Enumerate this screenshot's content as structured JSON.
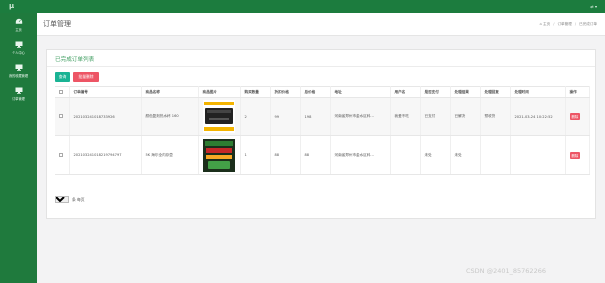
{
  "topbar": {
    "logo": "μ",
    "user_label": "⇄ ▾"
  },
  "sidebar": {
    "items": [
      {
        "label": "主页",
        "icon": "dashboard-icon"
      },
      {
        "label": "个人中心",
        "icon": "monitor-icon"
      },
      {
        "label": "我的收藏管理",
        "icon": "monitor-icon"
      },
      {
        "label": "订单管理",
        "icon": "monitor-icon"
      }
    ]
  },
  "header": {
    "title": "订单管理",
    "breadcrumb": [
      "⌂ 主页",
      "订单管理",
      "已完成订单"
    ]
  },
  "card": {
    "title": "已完成订单列表",
    "search_label": "查询",
    "batch_delete_label": "批量删除"
  },
  "table": {
    "columns": [
      "订单编号",
      "商品名称",
      "商品图片",
      "购买数量",
      "折扣价格",
      "总价格",
      "地址",
      "用户名",
      "是否支付",
      "处理结果",
      "处理回复",
      "处理时间",
      "操作"
    ],
    "rows": [
      {
        "order_no": "202103241018733926",
        "product": "颜色复刻热水杯 160",
        "image": "product-image-bag",
        "quantity": "2",
        "discount_price": "99",
        "total_price": "198",
        "address": "河南省郑州市金水区科...",
        "username": "我爱不吃",
        "paid": "已支付",
        "result": "已解决",
        "reply": "预收货",
        "time": "2021-03-24 10:22:52",
        "action": "删除"
      },
      {
        "order_no": "202103241018219794797",
        "product": "5K 海尔全内存壶",
        "image": "product-image-drink",
        "quantity": "1",
        "discount_price": "88",
        "total_price": "88",
        "address": "河南省郑州市金水区科...",
        "username": "",
        "paid": "未处",
        "result": "未处",
        "reply": "",
        "time": "",
        "action": "删除"
      }
    ]
  },
  "pager": {
    "page_size": "10",
    "suffix": "条 每页",
    "current_page": "1"
  },
  "watermark": "CSDN @2401_85762266",
  "colors": {
    "sidebar": "#1f7a3d",
    "accent": "#1ab394",
    "danger": "#ed5565"
  }
}
